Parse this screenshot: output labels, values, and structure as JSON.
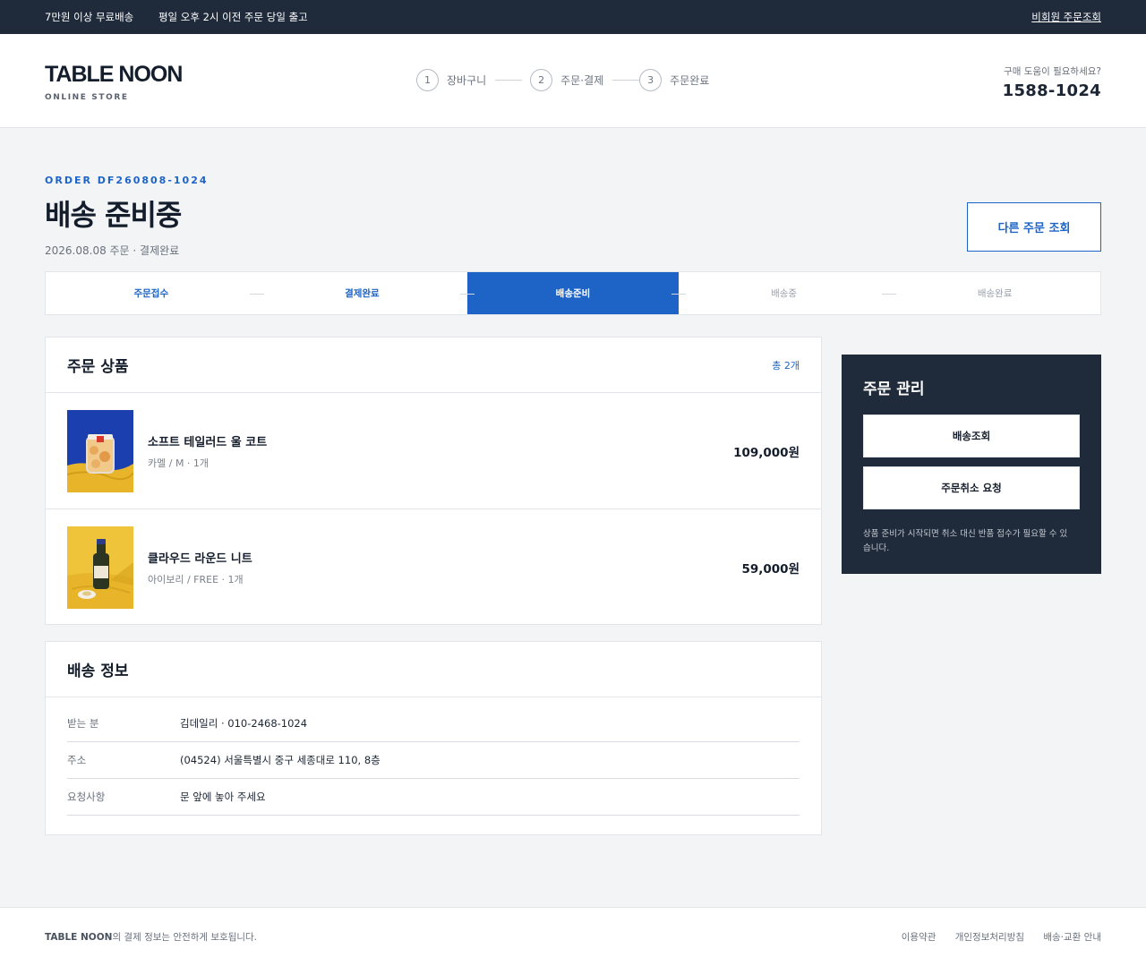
{
  "topbar": {
    "notice1": "7만원 이상 무료배송",
    "notice2": "평일 오후 2시 이전 주문 당일 출고",
    "guest_lookup": "비회원 주문조회"
  },
  "brand": {
    "name": "TABLE NOON",
    "sub": "ONLINE STORE"
  },
  "checkout_steps": [
    {
      "num": "1",
      "label": "장바구니"
    },
    {
      "num": "2",
      "label": "주문·결제"
    },
    {
      "num": "3",
      "label": "주문완료"
    }
  ],
  "help": {
    "question": "구매 도움이 필요하세요?",
    "phone": "1588-1024"
  },
  "order": {
    "number": "ORDER DF260808-1024",
    "status_title": "배송 준비중",
    "meta": "2026.08.08 주문 · 결제완료",
    "other_order_button": "다른 주문 조회"
  },
  "progress": [
    {
      "label": "주문접수",
      "state": "done"
    },
    {
      "label": "결제완료",
      "state": "done"
    },
    {
      "label": "배송준비",
      "state": "current"
    },
    {
      "label": "배송중",
      "state": "todo"
    },
    {
      "label": "배송완료",
      "state": "todo"
    }
  ],
  "products": {
    "title": "주문 상품",
    "count": "총 2개",
    "items": [
      {
        "name": "소프트 테일러드 울 코트",
        "option": "카멜 / M · 1개",
        "price": "109,000원",
        "image": "jar-on-blue-yellow"
      },
      {
        "name": "클라우드 라운드 니트",
        "option": "아이보리 / FREE · 1개",
        "price": "59,000원",
        "image": "bottle-on-yellow"
      }
    ]
  },
  "shipping": {
    "title": "배송 정보",
    "rows": [
      {
        "key": "받는 분",
        "value": "김데일리 · 010-2468-1024"
      },
      {
        "key": "주소",
        "value": "(04524) 서울특별시 중구 세종대로 110, 8층"
      },
      {
        "key": "요청사항",
        "value": "문 앞에 놓아 주세요"
      }
    ]
  },
  "manage": {
    "title": "주문 관리",
    "track_button": "배송조회",
    "cancel_button": "주문취소 요청",
    "note": "상품 준비가 시작되면 취소 대신 반품 접수가 필요할 수 있습니다."
  },
  "footer": {
    "brand": "TABLE NOON",
    "text": "의 결제 정보는 안전하게 보호됩니다.",
    "links": [
      "이용약관",
      "개인정보처리방침",
      "배송·교환 안내"
    ]
  },
  "colors": {
    "accent": "#1d64c6",
    "dark": "#1f2a3a",
    "background": "#f3f4f6"
  }
}
